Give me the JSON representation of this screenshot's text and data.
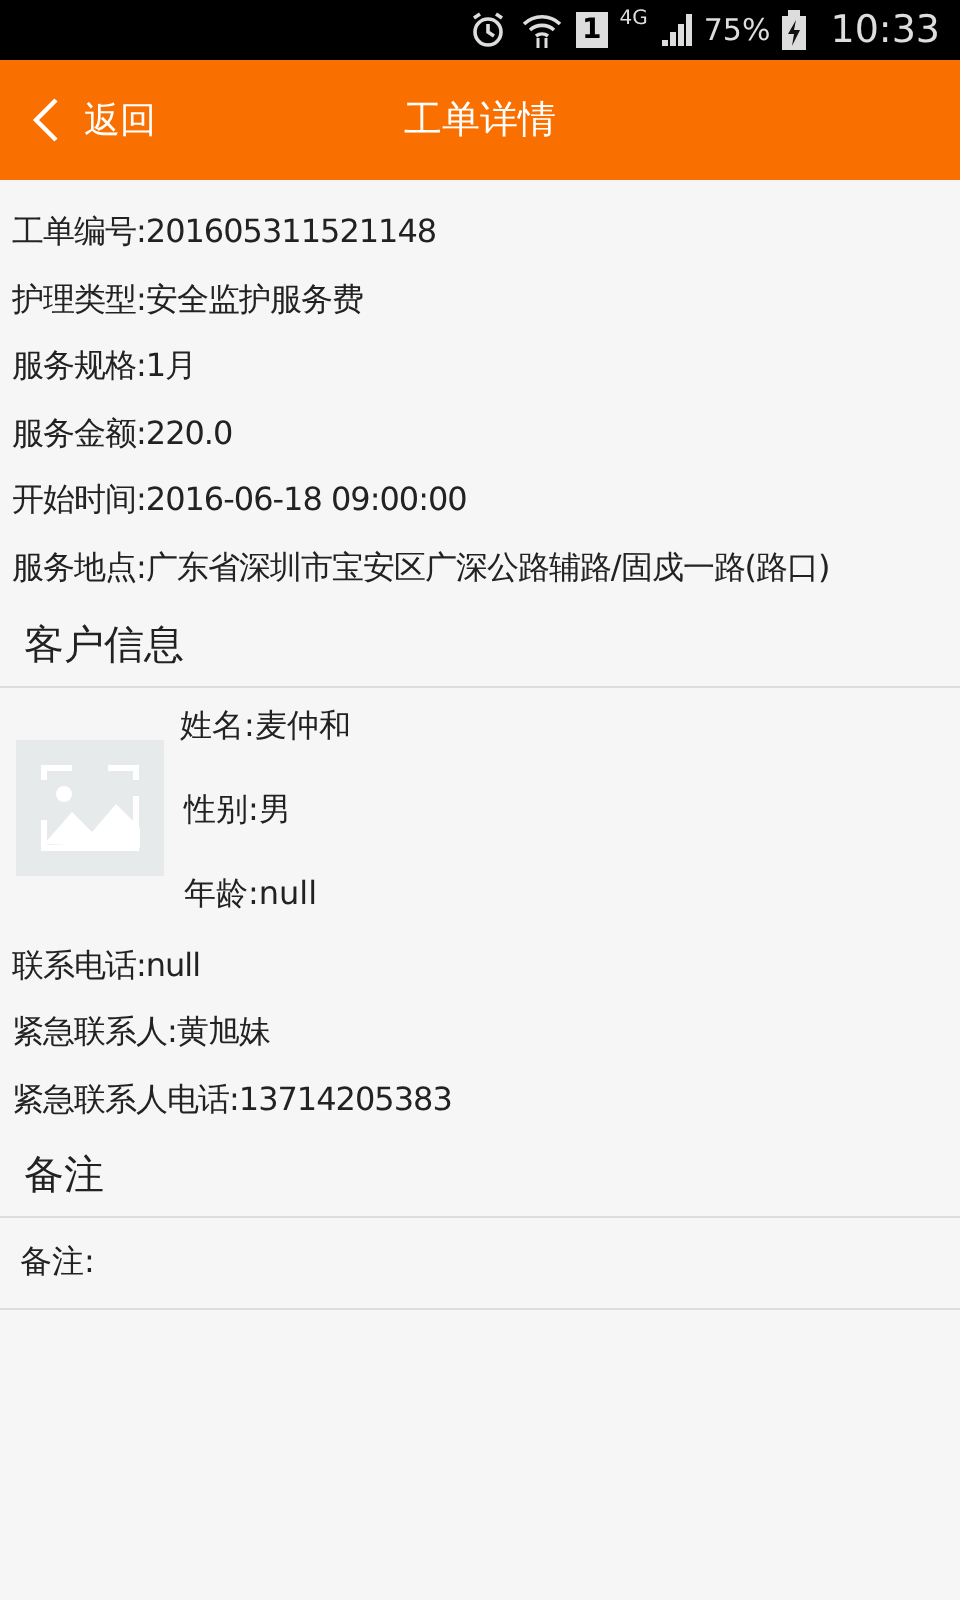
{
  "status_bar": {
    "sim": "1",
    "network": "4G",
    "battery": "75%",
    "time": "10:33"
  },
  "header": {
    "back": "返回",
    "title": "工单详情"
  },
  "order_fields": [
    "工单编号:201605311521148",
    "护理类型:安全监护服务费",
    "服务规格:1月",
    "服务金额:220.0",
    "开始时间:2016-06-18 09:00:00",
    "服务地点:广东省深圳市宝安区广深公路辅路/固戍一路(路口)"
  ],
  "customer": {
    "heading": "客户信息",
    "name": "姓名:麦仲和",
    "gender": "性别:男",
    "age": "年龄:null",
    "fields": [
      "联系电话:null",
      "紧急联系人:黄旭妹",
      "紧急联系人电话:13714205383"
    ]
  },
  "remarks": {
    "heading": "备注",
    "text": "备注:"
  }
}
